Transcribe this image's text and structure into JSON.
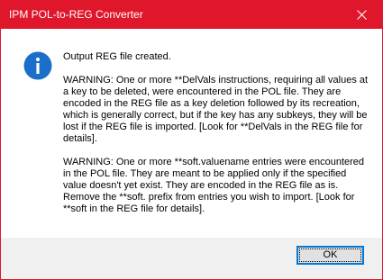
{
  "window": {
    "title": "IPM POL-to-REG Converter",
    "accent_color": "#e0162b",
    "close_icon": "close-icon"
  },
  "message": {
    "icon": "info-icon",
    "icon_color": "#1c6fc8",
    "paragraphs": [
      "Output REG file created.",
      "WARNING: One or more **DelVals instructions, requiring all values at a key to be deleted, were encountered in the POL file. They are encoded in the REG file as a key deletion followed by its recreation, which is generally correct, but if the key has any subkeys, they will be lost if the REG file is imported. [Look for **DelVals in the REG file for details].",
      "WARNING: One or more **soft.valuename entries were encountered in the POL file. They are meant to be applied only if the specified value doesn't yet exist. They are encoded in the REG file as is. Remove the **soft. prefix from entries you wish to import. [Look for **soft in the REG file for details]."
    ]
  },
  "buttons": {
    "ok_label": "OK",
    "focus_color": "#0078d7"
  }
}
